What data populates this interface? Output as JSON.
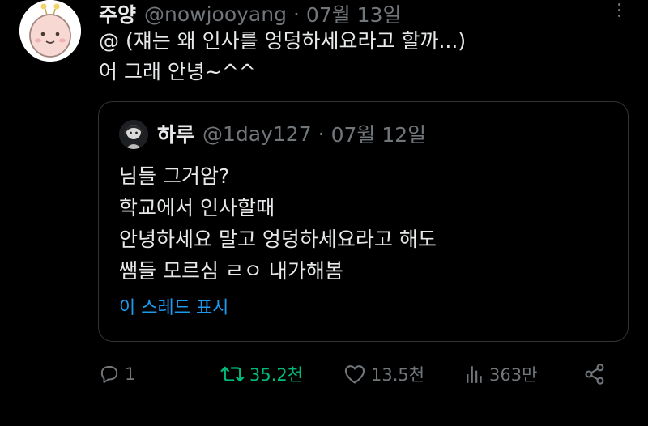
{
  "tweet": {
    "author_name": "주양",
    "author_handle": "@nowjooyang",
    "separator": "·",
    "date": "07월 13일",
    "body_lines": [
      "@ (쟤는 왜 인사를 엉덩하세요라고 할까...)",
      "어 그래 안녕~^^"
    ]
  },
  "quoted": {
    "author_name": "하루",
    "author_handle": "@1day127",
    "separator": "·",
    "date": "07월 12일",
    "body_lines": [
      "님들 그거암?",
      "학교에서 인사할때",
      "안녕하세요 말고 엉덩하세요라고 해도",
      "쌤들 모르심 ㄹㅇ 내가해봄"
    ],
    "show_thread": "이 스레드 표시"
  },
  "actions": {
    "reply_icon": "reply-icon",
    "reply_count": "1",
    "retweet_icon": "retweet-icon",
    "retweet_count": "35.2천",
    "like_icon": "heart-icon",
    "like_count": "13.5천",
    "views_icon": "bar-chart-icon",
    "views_count": "363만",
    "share_icon": "share-icon"
  },
  "colors": {
    "background": "#000000",
    "text": "#e7e9ea",
    "muted": "#71767b",
    "link": "#1d9bf0",
    "retweet_active": "#00ba7c",
    "border": "#2f3336"
  }
}
